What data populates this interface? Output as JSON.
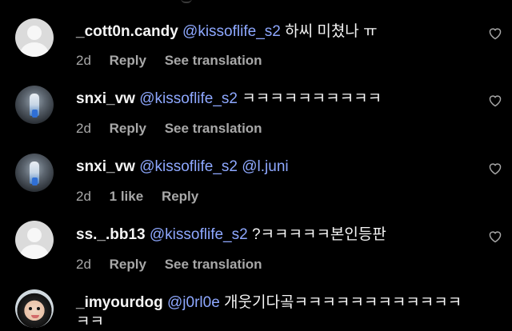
{
  "comments": [
    {
      "username": "_cott0n.candy",
      "mention": "@kissoflife_s2",
      "text": " 하씨 미쳤나 ㅠ",
      "time": "2d",
      "likes": "",
      "reply": "Reply",
      "see_translation": "See translation",
      "avatar": "default-avatar-icon"
    },
    {
      "username": "snxi_vw",
      "mention": "@kissoflife_s2",
      "text": " ㅋㅋㅋㅋㅋㅋㅋㅋㅋㅋ",
      "time": "2d",
      "likes": "",
      "reply": "Reply",
      "see_translation": "See translation",
      "avatar": "photo"
    },
    {
      "username": "snxi_vw",
      "mention": "@kissoflife_s2 @l.juni",
      "text": "",
      "time": "2d",
      "likes": "1 like",
      "reply": "Reply",
      "see_translation": "",
      "avatar": "photo"
    },
    {
      "username": "ss._.bb13",
      "mention": "@kissoflife_s2",
      "text": " ?ㅋㅋㅋㅋㅋ본인등판",
      "time": "2d",
      "likes": "",
      "reply": "Reply",
      "see_translation": "See translation",
      "avatar": "default-avatar-icon"
    },
    {
      "username": "_imyourdog",
      "mention": "@j0rl0e",
      "text": " 개웃기다곸ㅋㅋㅋㅋㅋㅋㅋㅋㅋㅋㅋㅋ",
      "continuation": "ㅋㅋ",
      "avatar": "child-photo"
    }
  ],
  "icons": {
    "like": "heart-icon"
  },
  "colors": {
    "background": "#000000",
    "mention": "#8ea8ff",
    "meta": "#a8a8a8"
  }
}
